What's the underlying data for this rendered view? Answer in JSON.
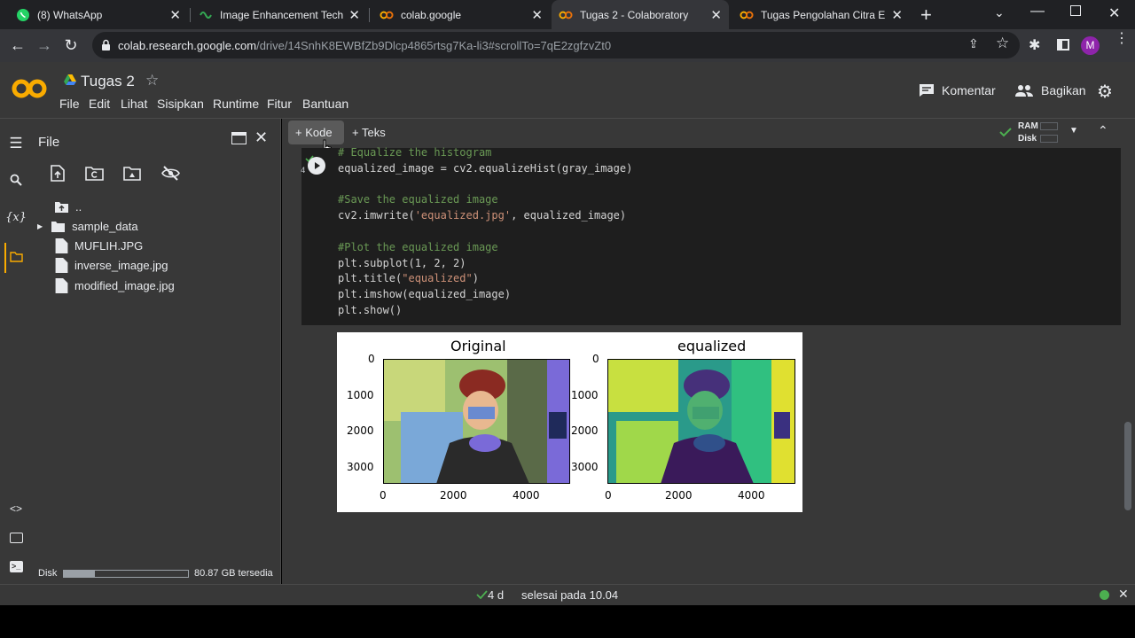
{
  "browser": {
    "tabs": [
      {
        "title": "(8) WhatsApp",
        "icon": "whatsapp-icon"
      },
      {
        "title": "Image Enhancement Techni",
        "icon": "site-icon"
      },
      {
        "title": "colab.google",
        "icon": "colab-icon"
      },
      {
        "title": "Tugas 2 - Colaboratory",
        "icon": "colab-icon",
        "active": true
      },
      {
        "title": "Tugas Pengolahan Citra Enh",
        "icon": "colab-icon"
      }
    ],
    "url_host": "colab.research.google.com",
    "url_path": "/drive/14SnhK8EWBfZb9Dlcp4865rtsg7Ka-li3#scrollTo=7qE2zgfzvZt0",
    "profile_initial": "M"
  },
  "colab": {
    "notebook_title": "Tugas 2",
    "menu": [
      "File",
      "Edit",
      "Lihat",
      "Sisipkan",
      "Runtime",
      "Fitur",
      "Bantuan"
    ],
    "comment_label": "Komentar",
    "share_label": "Bagikan",
    "add_code_label": "Kode",
    "add_text_label": "Teks",
    "ram_label": "RAM",
    "disk_label": "Disk"
  },
  "files": {
    "panel_title": "File",
    "items": [
      {
        "name": "..",
        "type": "up"
      },
      {
        "name": "sample_data",
        "type": "folder"
      },
      {
        "name": "MUFLIH.JPG",
        "type": "file"
      },
      {
        "name": "inverse_image.jpg",
        "type": "file"
      },
      {
        "name": "modified_image.jpg",
        "type": "file"
      }
    ],
    "disk_label": "Disk",
    "disk_free": "80.87 GB tersedia",
    "disk_used_fraction": 0.25
  },
  "cell": {
    "exec_time": "4 d",
    "lines": [
      {
        "cls": "cmt",
        "text": "# Equalize the histogram"
      },
      {
        "cls": "",
        "text": "equalized_image = cv2.equalizeHist(gray_image)"
      },
      {
        "cls": "",
        "text": ""
      },
      {
        "cls": "cmt",
        "text": "#Save the equalized image"
      },
      {
        "cls": "",
        "text": "cv2.imwrite('equalized.jpg', equalized_image)"
      },
      {
        "cls": "",
        "text": ""
      },
      {
        "cls": "cmt",
        "text": "#Plot the equalized image"
      },
      {
        "cls": "",
        "text": "plt.subplot(1, 2, 2)"
      },
      {
        "cls": "",
        "text": "plt.title(\"equalized\")"
      },
      {
        "cls": "",
        "text": "plt.imshow(equalized_image)"
      },
      {
        "cls": "",
        "text": "plt.show()"
      }
    ]
  },
  "plots": [
    {
      "title": "Original",
      "yticks": [
        "0",
        "1000",
        "2000",
        "3000"
      ],
      "xticks": [
        "0",
        "2000",
        "4000"
      ]
    },
    {
      "title": "equalized",
      "yticks": [
        "0",
        "1000",
        "2000",
        "3000"
      ],
      "xticks": [
        "0",
        "2000",
        "4000"
      ]
    }
  ],
  "status": {
    "time": "4 d",
    "text": "selesai pada 10.04"
  },
  "colors": {
    "accent": "#f9ab00",
    "ok": "#4caf50",
    "profile": "#8e24aa"
  }
}
